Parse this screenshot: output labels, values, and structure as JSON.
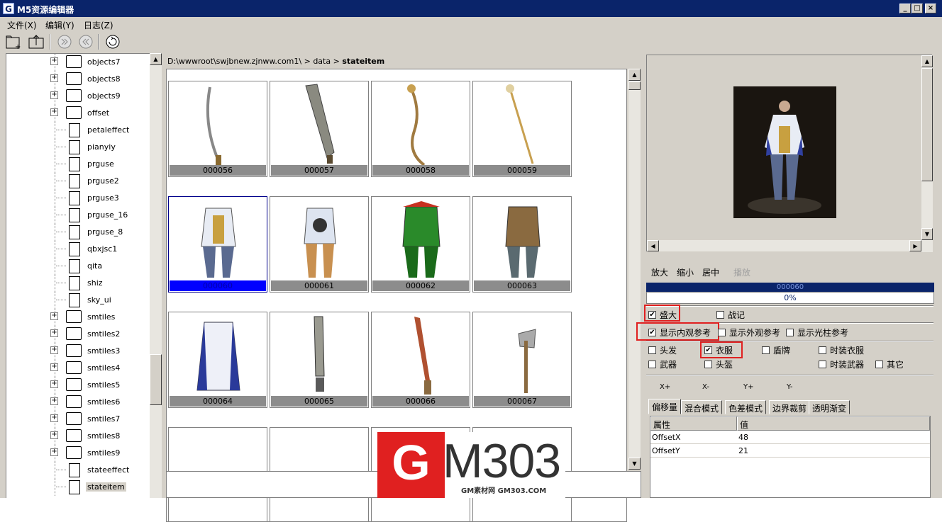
{
  "window": {
    "app_icon": "G",
    "title": "M5资源编辑器",
    "minimize": "_",
    "maximize": "□",
    "close": "×"
  },
  "menu": [
    "文件(X)",
    "编辑(Y)",
    "日志(Z)"
  ],
  "toolbar_icons": [
    "new-folder-icon",
    "upload-icon",
    "forward-icon",
    "back-icon",
    "refresh-icon"
  ],
  "tree": {
    "items": [
      {
        "label": "objects7",
        "type": "folder"
      },
      {
        "label": "objects8",
        "type": "folder"
      },
      {
        "label": "objects9",
        "type": "folder"
      },
      {
        "label": "offset",
        "type": "folder"
      },
      {
        "label": "petaleffect",
        "type": "file"
      },
      {
        "label": "pianyiy",
        "type": "file"
      },
      {
        "label": "prguse",
        "type": "file"
      },
      {
        "label": "prguse2",
        "type": "file"
      },
      {
        "label": "prguse3",
        "type": "file"
      },
      {
        "label": "prguse_16",
        "type": "file"
      },
      {
        "label": "prguse_8",
        "type": "file"
      },
      {
        "label": "qbxjsc1",
        "type": "file"
      },
      {
        "label": "qita",
        "type": "file"
      },
      {
        "label": "shiz",
        "type": "file"
      },
      {
        "label": "sky_ui",
        "type": "file"
      },
      {
        "label": "smtiles",
        "type": "folder"
      },
      {
        "label": "smtiles2",
        "type": "folder"
      },
      {
        "label": "smtiles3",
        "type": "folder"
      },
      {
        "label": "smtiles4",
        "type": "folder"
      },
      {
        "label": "smtiles5",
        "type": "folder"
      },
      {
        "label": "smtiles6",
        "type": "folder"
      },
      {
        "label": "smtiles7",
        "type": "folder"
      },
      {
        "label": "smtiles8",
        "type": "folder"
      },
      {
        "label": "smtiles9",
        "type": "folder"
      },
      {
        "label": "stateeffect",
        "type": "file"
      },
      {
        "label": "stateitem",
        "type": "file",
        "selected": true
      }
    ]
  },
  "path": {
    "root": "D:\\wwwroot\\swjbnew.zjnww.com1\\",
    "sep1": ">",
    "mid": "data",
    "sep2": ">",
    "current": "stateitem"
  },
  "grid": {
    "items": [
      {
        "id": "000056",
        "kind": "curved sword"
      },
      {
        "id": "000057",
        "kind": "broad blade"
      },
      {
        "id": "000058",
        "kind": "twisted staff"
      },
      {
        "id": "000059",
        "kind": "ornate staff"
      },
      {
        "id": "000060",
        "kind": "white robe",
        "selected": true
      },
      {
        "id": "000061",
        "kind": "armor"
      },
      {
        "id": "000062",
        "kind": "green armor"
      },
      {
        "id": "000063",
        "kind": "brown armor"
      },
      {
        "id": "000064",
        "kind": "blue robe"
      },
      {
        "id": "000065",
        "kind": "long sword"
      },
      {
        "id": "000066",
        "kind": "red sword"
      },
      {
        "id": "000067",
        "kind": "axe"
      },
      {
        "id": "",
        "kind": "partial"
      },
      {
        "id": "",
        "kind": "partial"
      },
      {
        "id": "",
        "kind": "partial"
      },
      {
        "id": "",
        "kind": "partial"
      }
    ]
  },
  "zoom": {
    "zoom_in": "放大",
    "zoom_out": "缩小",
    "center": "居中",
    "play": "播放"
  },
  "progress": {
    "label": "000060",
    "percent_text": "0%",
    "percent": 0
  },
  "options": {
    "shengda": "盛大",
    "shengda_checked": true,
    "zhanji": "战记",
    "zhanji_checked": false,
    "show_inner": "显示内观参考",
    "show_inner_checked": true,
    "show_outer": "显示外观参考",
    "show_outer_checked": false,
    "show_light": "显示光柱参考",
    "show_light_checked": false,
    "hair": "头发",
    "clothes": "衣服",
    "clothes_checked": true,
    "shield": "盾牌",
    "fashion_clothes": "时装衣服",
    "weapon": "武器",
    "helmet": "头盔",
    "fashion_weapon": "时装武器",
    "other": "其它"
  },
  "offset_buttons": [
    "X+",
    "X-",
    "Y+",
    "Y-"
  ],
  "tabs": [
    "偏移量",
    "混合模式",
    "色差模式",
    "边界裁剪",
    "透明渐变"
  ],
  "properties": {
    "headers": [
      "属性",
      "值"
    ],
    "rows": [
      {
        "name": "OffsetX",
        "value": "48"
      },
      {
        "name": "OffsetY",
        "value": "21"
      }
    ]
  },
  "watermark": {
    "g": "G",
    "text": "M303",
    "sub": "GM素材网 GM303.COM"
  },
  "colors": {
    "titlebar": "#0a246a",
    "selection": "#0000ff",
    "highlight_box": "#e02020"
  }
}
